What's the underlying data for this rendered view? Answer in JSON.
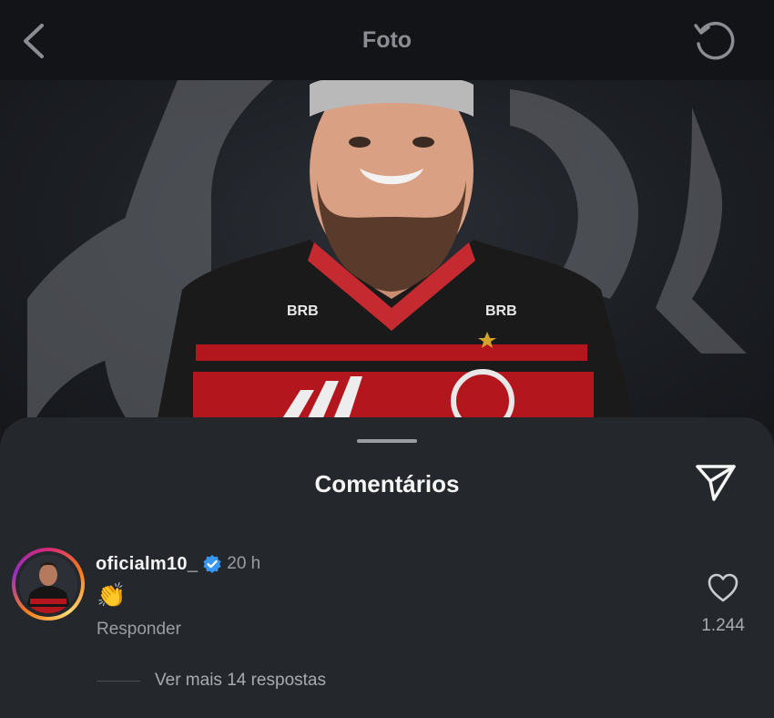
{
  "header": {
    "title": "Foto",
    "back_icon": "chevron-left-icon",
    "undo_icon": "rotate-ccw-icon"
  },
  "photo": {
    "jersey_brand_left": "BRB",
    "jersey_brand_right": "BRB",
    "colors": {
      "stripe_red": "#b3161d",
      "stripe_black": "#141414"
    }
  },
  "comments_sheet": {
    "title": "Comentários",
    "share_icon": "send-icon",
    "comment": {
      "username": "oficialm10_",
      "verified": true,
      "time": "20 h",
      "text": "👏",
      "reply_label": "Responder",
      "like_count": "1.244",
      "more_replies": "Ver mais 14 respostas"
    }
  }
}
